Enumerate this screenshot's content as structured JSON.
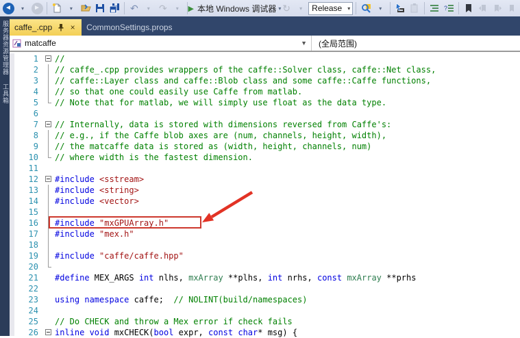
{
  "toolbar": {
    "run_label": "本地 Windows 调试器",
    "release_combo": "Release",
    "icons": [
      "navigate-back",
      "navigate-forward",
      "new-file",
      "add-item",
      "save",
      "save-all",
      "undo",
      "redo",
      "start-debug",
      "refresh",
      "find-in-files",
      "navigate-to",
      "paste",
      "comment-lines",
      "uncomment-lines",
      "toggle-bookmark"
    ]
  },
  "sidebar": {
    "items": [
      {
        "label": "服务器资源管理器"
      },
      {
        "label": "工具箱"
      }
    ]
  },
  "tabs": [
    {
      "label": "caffe_.cpp",
      "active": true
    },
    {
      "label": "CommonSettings.props",
      "active": false
    }
  ],
  "navbar": {
    "scope": "matcaffe",
    "member": "(全局范围)"
  },
  "editor": {
    "highlighted_line": 16,
    "highlight_color": "#cd372c",
    "lines": [
      {
        "n": 1,
        "g": "box",
        "tokens": [
          {
            "c": "c",
            "t": "//"
          }
        ]
      },
      {
        "n": 2,
        "g": "line",
        "tokens": [
          {
            "c": "c",
            "t": "// caffe_.cpp provides wrappers of the caffe::Solver class, caffe::Net class,"
          }
        ]
      },
      {
        "n": 3,
        "g": "line",
        "tokens": [
          {
            "c": "c",
            "t": "// caffe::Layer class and caffe::Blob class and some caffe::Caffe functions,"
          }
        ]
      },
      {
        "n": 4,
        "g": "line",
        "tokens": [
          {
            "c": "c",
            "t": "// so that one could easily use Caffe from matlab."
          }
        ]
      },
      {
        "n": 5,
        "g": "corner",
        "tokens": [
          {
            "c": "c",
            "t": "// Note that for matlab, we will simply use float as the data type."
          }
        ]
      },
      {
        "n": 6,
        "g": "",
        "tokens": []
      },
      {
        "n": 7,
        "g": "box",
        "tokens": [
          {
            "c": "c",
            "t": "// Internally, data is stored with dimensions reversed from Caffe's:"
          }
        ]
      },
      {
        "n": 8,
        "g": "line",
        "tokens": [
          {
            "c": "c",
            "t": "// e.g., if the Caffe blob axes are (num, channels, height, width),"
          }
        ]
      },
      {
        "n": 9,
        "g": "line",
        "tokens": [
          {
            "c": "c",
            "t": "// the matcaffe data is stored as (width, height, channels, num)"
          }
        ]
      },
      {
        "n": 10,
        "g": "corner",
        "tokens": [
          {
            "c": "c",
            "t": "// where width is the fastest dimension."
          }
        ]
      },
      {
        "n": 11,
        "g": "",
        "tokens": []
      },
      {
        "n": 12,
        "g": "box",
        "tokens": [
          {
            "c": "k",
            "t": "#include "
          },
          {
            "c": "s",
            "t": "<sstream>"
          }
        ]
      },
      {
        "n": 13,
        "g": "line",
        "tokens": [
          {
            "c": "k",
            "t": "#include "
          },
          {
            "c": "s",
            "t": "<string>"
          }
        ]
      },
      {
        "n": 14,
        "g": "line",
        "tokens": [
          {
            "c": "k",
            "t": "#include "
          },
          {
            "c": "s",
            "t": "<vector>"
          }
        ]
      },
      {
        "n": 15,
        "g": "line",
        "tokens": []
      },
      {
        "n": 16,
        "g": "line",
        "boxed": true,
        "tokens": [
          {
            "c": "k",
            "t": "#include "
          },
          {
            "c": "s",
            "t": "\"mxGPUArray.h\""
          }
        ]
      },
      {
        "n": 17,
        "g": "line",
        "tokens": [
          {
            "c": "k",
            "t": "#include "
          },
          {
            "c": "s",
            "t": "\"mex.h\""
          }
        ]
      },
      {
        "n": 18,
        "g": "line",
        "tokens": []
      },
      {
        "n": 19,
        "g": "line",
        "tokens": [
          {
            "c": "k",
            "t": "#include "
          },
          {
            "c": "s",
            "t": "\"caffe/caffe.hpp\""
          }
        ]
      },
      {
        "n": 20,
        "g": "corner",
        "tokens": []
      },
      {
        "n": 21,
        "g": "",
        "tokens": [
          {
            "c": "k",
            "t": "#define"
          },
          {
            "c": "p",
            "t": " MEX_ARGS "
          },
          {
            "c": "k",
            "t": "int"
          },
          {
            "c": "p",
            "t": " nlhs, "
          },
          {
            "c": "t",
            "t": "mxArray"
          },
          {
            "c": "p",
            "t": " **plhs, "
          },
          {
            "c": "k",
            "t": "int"
          },
          {
            "c": "p",
            "t": " nrhs, "
          },
          {
            "c": "k",
            "t": "const"
          },
          {
            "c": "p",
            "t": " "
          },
          {
            "c": "t",
            "t": "mxArray"
          },
          {
            "c": "p",
            "t": " **prhs"
          }
        ]
      },
      {
        "n": 22,
        "g": "",
        "tokens": []
      },
      {
        "n": 23,
        "g": "",
        "tokens": [
          {
            "c": "k",
            "t": "using namespace"
          },
          {
            "c": "p",
            "t": " caffe;  "
          },
          {
            "c": "c",
            "t": "// NOLINT(build/namespaces)"
          }
        ]
      },
      {
        "n": 24,
        "g": "",
        "tokens": []
      },
      {
        "n": 25,
        "g": "",
        "tokens": [
          {
            "c": "c",
            "t": "// Do CHECK and throw a Mex error if check fails"
          }
        ]
      },
      {
        "n": 26,
        "g": "box",
        "tokens": [
          {
            "c": "k",
            "t": "inline void"
          },
          {
            "c": "p",
            "t": " mxCHECK("
          },
          {
            "c": "k",
            "t": "bool"
          },
          {
            "c": "p",
            "t": " expr, "
          },
          {
            "c": "k",
            "t": "const char"
          },
          {
            "c": "p",
            "t": "* msg) {"
          }
        ]
      }
    ]
  }
}
